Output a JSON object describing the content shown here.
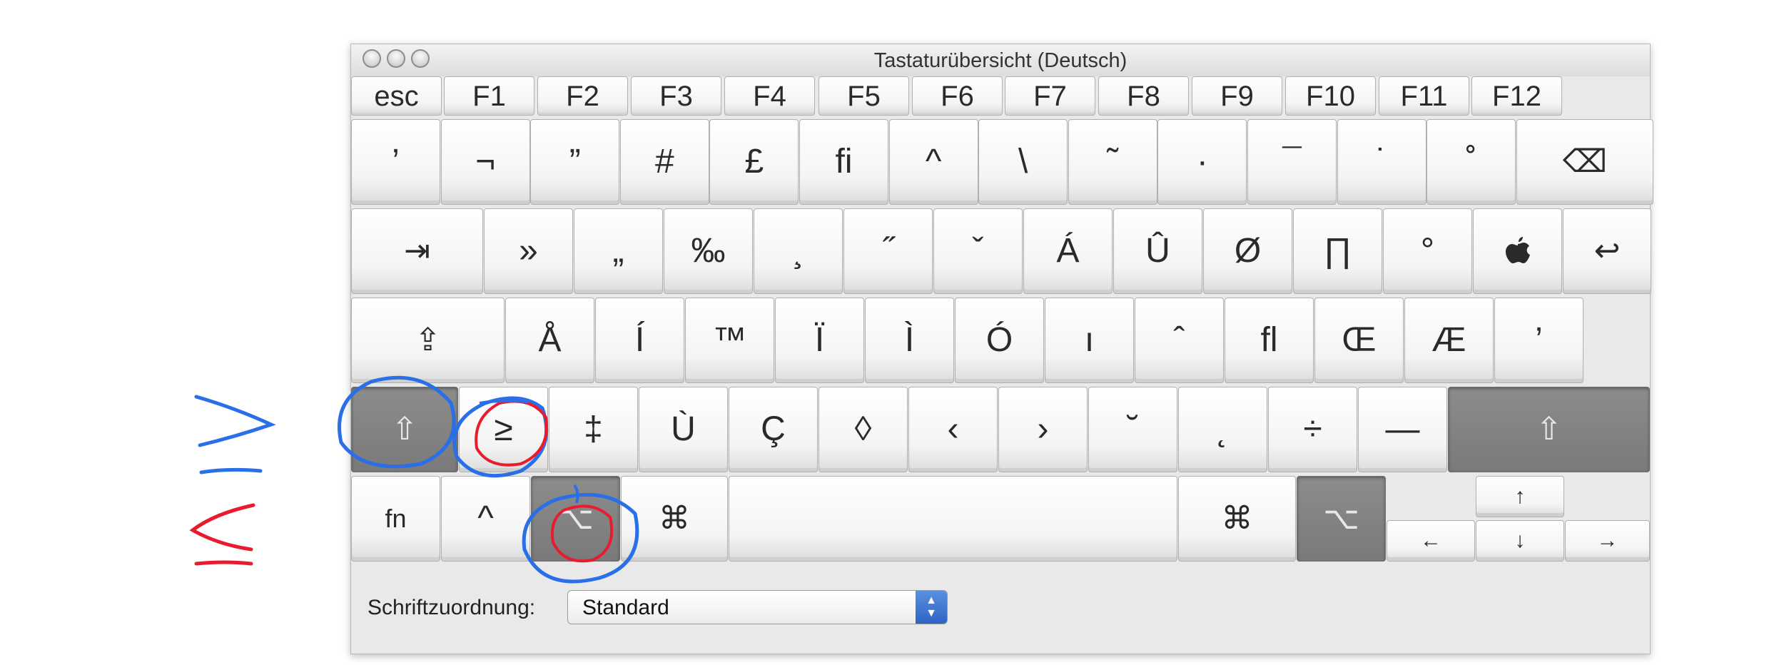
{
  "window": {
    "title": "Tastaturübersicht (Deutsch)"
  },
  "rows": {
    "function": [
      {
        "label": "esc",
        "name": "key-esc"
      },
      {
        "label": "F1",
        "name": "key-f1"
      },
      {
        "label": "F2",
        "name": "key-f2"
      },
      {
        "label": "F3",
        "name": "key-f3"
      },
      {
        "label": "F4",
        "name": "key-f4"
      },
      {
        "label": "F5",
        "name": "key-f5"
      },
      {
        "label": "F6",
        "name": "key-f6"
      },
      {
        "label": "F7",
        "name": "key-f7"
      },
      {
        "label": "F8",
        "name": "key-f8"
      },
      {
        "label": "F9",
        "name": "key-f9"
      },
      {
        "label": "F10",
        "name": "key-f10"
      },
      {
        "label": "F11",
        "name": "key-f11"
      },
      {
        "label": "F12",
        "name": "key-f12"
      }
    ],
    "number": [
      "’",
      "¬",
      "”",
      "#",
      "£",
      "ﬁ",
      "^",
      "\\",
      "˜",
      "·",
      "¯",
      "˙",
      "˚",
      "⌫"
    ],
    "top": [
      "⇥",
      "»",
      "„",
      "‰",
      "¸",
      "˝",
      "ˇ",
      "Á",
      "Û",
      "Ø",
      "∏",
      "°",
      "",
      "↩"
    ],
    "home": [
      "⇪",
      "Å",
      "Í",
      "™",
      "Ï",
      "Ì",
      "Ó",
      "ı",
      "ˆ",
      "ﬂ",
      "Œ",
      "Æ",
      "’"
    ],
    "bottom": [
      "⇧",
      "≥",
      "‡",
      "Ù",
      "Ç",
      "◊",
      "‹",
      "›",
      "˘",
      "˛",
      "÷",
      "—",
      "⇧"
    ],
    "modifiers": {
      "fn": "fn",
      "control": "^",
      "option_left": "⌥",
      "command_left": "⌘",
      "space": "",
      "command_right": "⌘",
      "option_right": "⌥"
    },
    "arrows": {
      "up": "↑",
      "left": "←",
      "down": "↓",
      "right": "→"
    }
  },
  "pressed": [
    "bottom-0",
    "bottom-12",
    "option_left",
    "option_right"
  ],
  "footer": {
    "label": "Schriftzuordnung:",
    "select_value": "Standard",
    "stepper_up": "▲",
    "stepper_down": "▼"
  },
  "annotation_colors": {
    "blue": "#2a6ee8",
    "red": "#e81c2c"
  }
}
